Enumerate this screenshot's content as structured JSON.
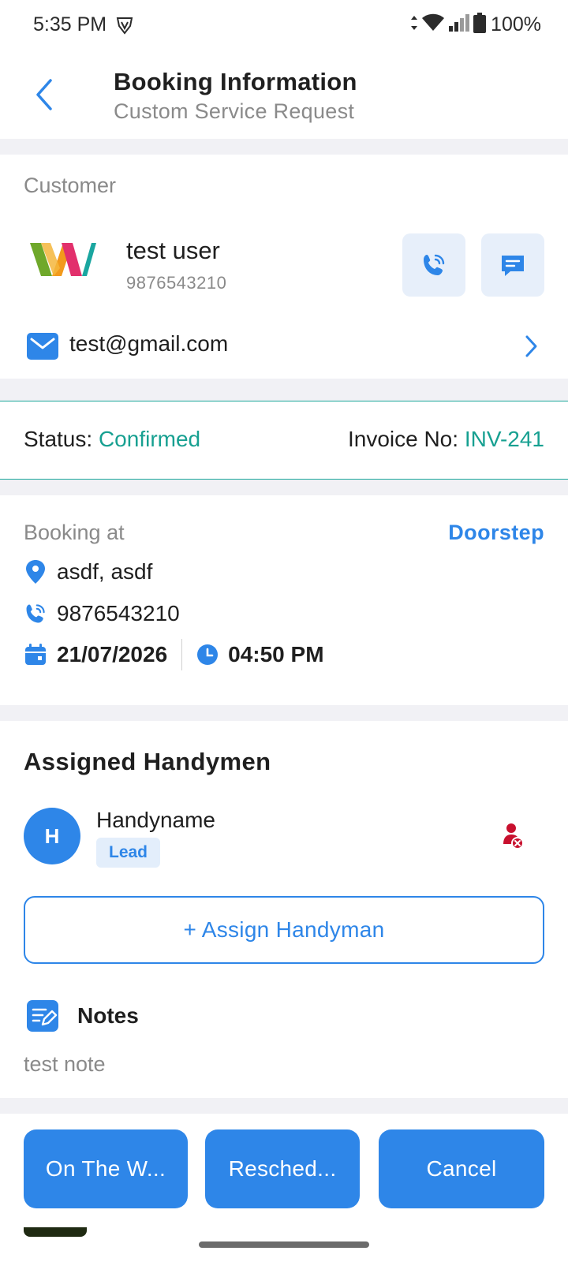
{
  "status_bar": {
    "time": "5:35 PM",
    "battery": "100%"
  },
  "header": {
    "title": "Booking Information",
    "subtitle": "Custom Service Request"
  },
  "customer": {
    "section_label": "Customer",
    "name": "test user",
    "phone": "9876543210",
    "email": "test@gmail.com"
  },
  "status": {
    "status_label": "Status:",
    "status_value": "Confirmed",
    "invoice_label": "Invoice No:",
    "invoice_value": "INV-241"
  },
  "booking": {
    "label": "Booking at",
    "type": "Doorstep",
    "address": "asdf, asdf",
    "phone": "9876543210",
    "date": "21/07/2026",
    "time": "04:50 PM"
  },
  "handymen": {
    "title": "Assigned Handymen",
    "items": [
      {
        "initial": "H",
        "name": "Handyname",
        "role": "Lead"
      }
    ],
    "assign_button": "+ Assign Handyman"
  },
  "notes": {
    "title": "Notes",
    "text": "test note"
  },
  "actions": {
    "on_the_way": "On The W...",
    "reschedule": "Resched...",
    "cancel": "Cancel"
  },
  "colors": {
    "accent": "#2e86e8",
    "teal": "#17a091",
    "danger": "#c8102e"
  }
}
